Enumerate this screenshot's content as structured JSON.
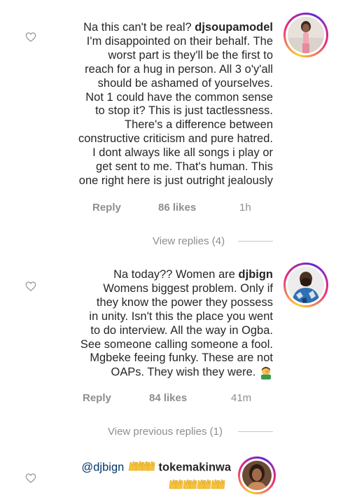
{
  "comments": [
    {
      "username": "djsoupamodel",
      "lines": [
        "Na this can't be real?",
        "I'm disappointed  on their behalf.  The",
        "worst part is they'll be the first to",
        "reach for a hug in person. All 3 o'y'all",
        "should be ashamed of yourselves.",
        "Not 1 could have the common sense",
        "to stop it?  This is just tactlessness.",
        "There's a difference between",
        "constructive criticism and pure hatred.",
        "I dont always like all songs i play or",
        "get sent to me. That's human. This",
        "one right here is just outright jealously"
      ],
      "reply_label": "Reply",
      "likes": "86 likes",
      "time": "1h",
      "view_replies": "View replies (4)",
      "heart_icon": "heart-outline-icon",
      "avatar_icon": "avatar-photo"
    },
    {
      "username": "djbign",
      "lines": [
        "Na today?? Women are",
        "Womens biggest problem. Only if",
        "they know the power they possess",
        "in unity. Isn't this the place you went",
        "to do interview. All the way in Ogba.",
        "See someone calling someone a fool.",
        "Mgbeke feeing funky. These are not",
        "OAPs. They wish they were."
      ],
      "reply_label": "Reply",
      "likes": "84 likes",
      "time": "41m",
      "view_replies": "View previous replies (1)",
      "emoji": "man-facepalming-emoji",
      "heart_icon": "heart-outline-icon",
      "avatar_icon": "avatar-photo"
    },
    {
      "mention": "@djbign",
      "username": "tokemakinwa",
      "emoji": "raising-hands-emoji",
      "heart_icon": "heart-outline-icon",
      "avatar_icon": "avatar-photo"
    }
  ],
  "colors": {
    "text": "#262626",
    "muted": "#8e8e8e",
    "mention": "#003569",
    "story_ring": "#ee2a7b"
  }
}
